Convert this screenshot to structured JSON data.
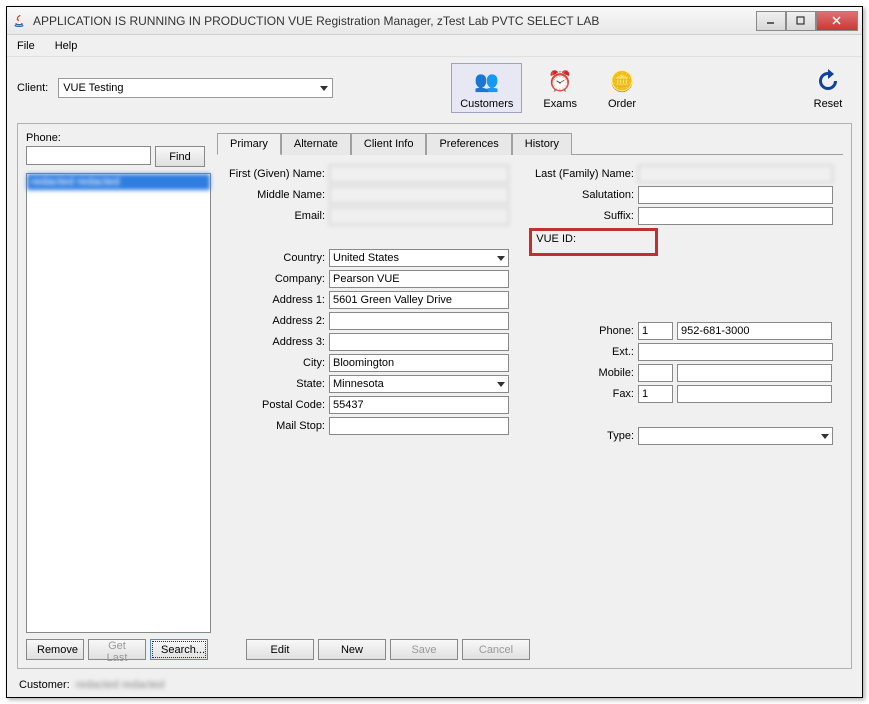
{
  "window": {
    "title": "APPLICATION IS RUNNING IN PRODUCTION  VUE Registration Manager, zTest Lab PVTC SELECT LAB"
  },
  "menu": {
    "file": "File",
    "help": "Help"
  },
  "client": {
    "label": "Client:",
    "value": "VUE Testing"
  },
  "toolbar": {
    "customers": "Customers",
    "exams": "Exams",
    "order": "Order",
    "reset": "Reset"
  },
  "left": {
    "phone_label": "Phone:",
    "find": "Find",
    "result_item": "redacted redacted"
  },
  "tabs": {
    "primary": "Primary",
    "alternate": "Alternate",
    "client_info": "Client Info",
    "preferences": "Preferences",
    "history": "History"
  },
  "form": {
    "first_name_lbl": "First (Given) Name:",
    "first_name": "   ",
    "middle_name_lbl": "Middle Name:",
    "middle_name": "    ",
    "email_lbl": "Email:",
    "email": "                    ",
    "country_lbl": "Country:",
    "country": "United States",
    "company_lbl": "Company:",
    "company": "Pearson VUE",
    "address1_lbl": "Address 1:",
    "address1": "5601 Green Valley Drive",
    "address2_lbl": "Address 2:",
    "address2": "",
    "address3_lbl": "Address 3:",
    "address3": "",
    "city_lbl": "City:",
    "city": "Bloomington",
    "state_lbl": "State:",
    "state": "Minnesota",
    "postal_lbl": "Postal Code:",
    "postal": "55437",
    "mailstop_lbl": "Mail Stop:",
    "mailstop": "",
    "last_name_lbl": "Last (Family) Name:",
    "last_name": "     ",
    "salutation_lbl": "Salutation:",
    "salutation": "",
    "suffix_lbl": "Suffix:",
    "suffix": "",
    "vue_id_lbl": "VUE ID:",
    "vue_id": "          ",
    "phone_lbl": "Phone:",
    "phone_cc": "1",
    "phone": "952-681-3000",
    "ext_lbl": "Ext.:",
    "ext": "",
    "mobile_lbl": "Mobile:",
    "mobile_cc": "",
    "mobile": "",
    "fax_lbl": "Fax:",
    "fax_cc": "1",
    "fax": "",
    "type_lbl": "Type:",
    "type": ""
  },
  "buttons": {
    "remove": "Remove",
    "get_last": "Get Last",
    "search": "Search...",
    "edit": "Edit",
    "new": "New",
    "save": "Save",
    "cancel": "Cancel"
  },
  "status": {
    "customer_lbl": "Customer:",
    "customer_val": "redacted redacted"
  }
}
